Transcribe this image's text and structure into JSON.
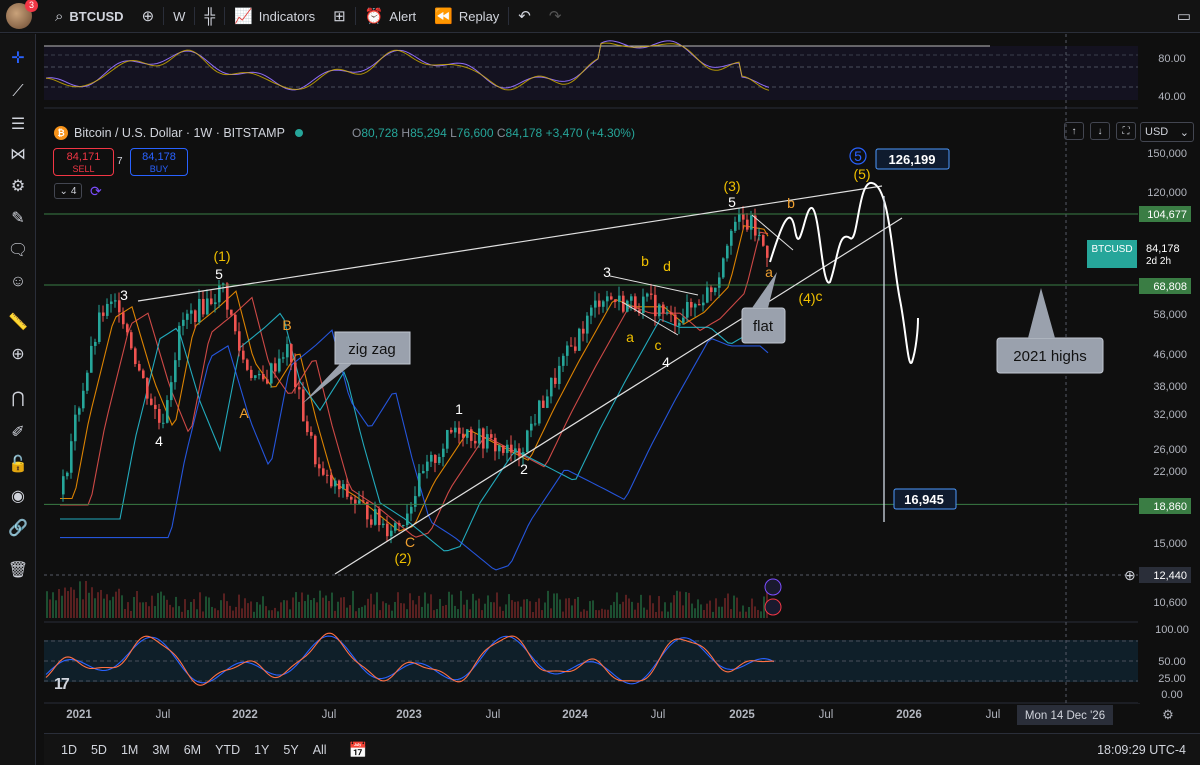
{
  "topbar": {
    "notification_count": "3",
    "symbol": "BTCUSD",
    "interval": "W",
    "indicators_label": "Indicators",
    "alert_label": "Alert",
    "replay_label": "Replay"
  },
  "header": {
    "title": "Bitcoin / U.S. Dollar · 1W · BITSTAMP",
    "open_label": "O",
    "open": "80,728",
    "high_label": "H",
    "high": "85,294",
    "low_label": "L",
    "low": "76,600",
    "close_label": "C",
    "close": "84,178",
    "change": "+3,470 (+4.30%)",
    "sell_price": "84,171",
    "sell_label": "SELL",
    "spread": "7",
    "buy_price": "84,178",
    "buy_label": "BUY",
    "indicator_count": "4",
    "currency": "USD"
  },
  "price_axis": {
    "ticks": [
      "150,000",
      "120,000",
      "104,677",
      "84,178",
      "68,808",
      "58,000",
      "46,000",
      "38,000",
      "32,000",
      "26,000",
      "22,000",
      "18,860",
      "15,000",
      "12,440",
      "10,600"
    ],
    "rsi_ticks": [
      "80.00",
      "40.00"
    ],
    "stoch_ticks": [
      "100.00",
      "50.00",
      "25.00",
      "0.00"
    ],
    "current_symbol": "BTCUSD",
    "current_countdown": "2d 2h"
  },
  "time_axis": {
    "labels": [
      "2021",
      "Jul",
      "2022",
      "Jul",
      "2023",
      "Jul",
      "2024",
      "Jul",
      "2025",
      "Jul",
      "2026",
      "Jul"
    ],
    "crosshair_date": "Mon 14 Dec '26"
  },
  "annotations": {
    "wave_labels": [
      "3",
      "4",
      "(1)",
      "5",
      "A",
      "B",
      "(2)",
      "C",
      "1",
      "2",
      "3",
      "a",
      "b",
      "c",
      "d",
      "4",
      "5",
      "(3)",
      "a",
      "b",
      "(4)",
      "c",
      "(5)",
      "5"
    ],
    "callouts": [
      "zig zag",
      "flat",
      "2021 highs"
    ],
    "price_tags": [
      "126,199",
      "16,945"
    ]
  },
  "bottombar": {
    "timeframes": [
      "1D",
      "5D",
      "1M",
      "3M",
      "6M",
      "YTD",
      "1Y",
      "5Y",
      "All"
    ],
    "clock": "18:09:29 UTC-4"
  },
  "colors": {
    "background": "#0f0f0f",
    "up": "#26a69a",
    "down": "#ef5350",
    "accent": "#2962ff",
    "horizontal_line": "#3a7d44",
    "wave_label": "#f0c000"
  }
}
